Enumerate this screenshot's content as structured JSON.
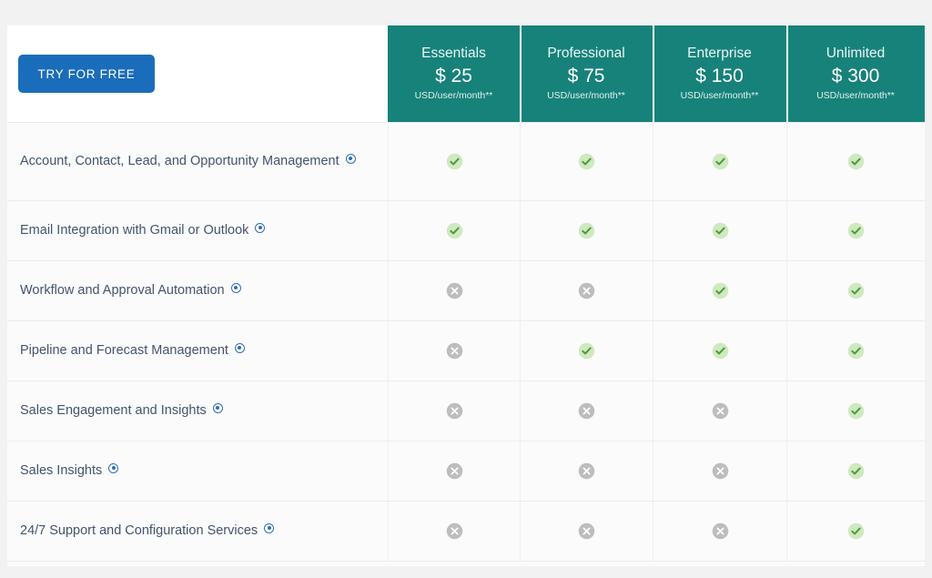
{
  "card": {
    "cta": {
      "label": "TRY FOR FREE",
      "color": "#1a6dba"
    }
  },
  "colors": {
    "header_teal": "#16827a",
    "cta_blue": "#1a6dba",
    "check_green": "#4d9a3a",
    "check_bg": "#cfe9c0",
    "cross_gray": "#bdbdbd",
    "label_text": "#44546b",
    "page_bg": "#f2f2f3",
    "card_bg": "#ffffff",
    "row_bg": "#fbfbfc",
    "divider": "#ececef"
  },
  "plans": [
    {
      "name": "Essentials",
      "price": "$ 25",
      "unit": "USD/user/month**"
    },
    {
      "name": "Professional",
      "price": "$ 75",
      "unit": "USD/user/month**"
    },
    {
      "name": "Enterprise",
      "price": "$ 150",
      "unit": "USD/user/month**"
    },
    {
      "name": "Unlimited",
      "price": "$ 300",
      "unit": "USD/user/month**"
    }
  ],
  "features": [
    {
      "label": "Account, Contact, Lead, and Opportunity Management",
      "info": "info-icon",
      "availability": [
        "check",
        "check",
        "check",
        "check"
      ]
    },
    {
      "label": "Email Integration with Gmail or Outlook",
      "info": "info-icon",
      "availability": [
        "check",
        "check",
        "check",
        "check"
      ]
    },
    {
      "label": "Workflow and Approval Automation",
      "info": "info-icon",
      "availability": [
        "cross",
        "cross",
        "check",
        "check"
      ]
    },
    {
      "label": "Pipeline and Forecast Management",
      "info": "info-icon",
      "availability": [
        "cross",
        "check",
        "check",
        "check"
      ]
    },
    {
      "label": "Sales Engagement and Insights",
      "info": "info-icon",
      "availability": [
        "cross",
        "cross",
        "cross",
        "check"
      ]
    },
    {
      "label": "Sales Insights",
      "info": "info-icon",
      "availability": [
        "cross",
        "cross",
        "cross",
        "check"
      ]
    },
    {
      "label": "24/7 Support and Configuration Services",
      "info": "info-icon",
      "availability": [
        "cross",
        "cross",
        "cross",
        "check"
      ]
    }
  ]
}
